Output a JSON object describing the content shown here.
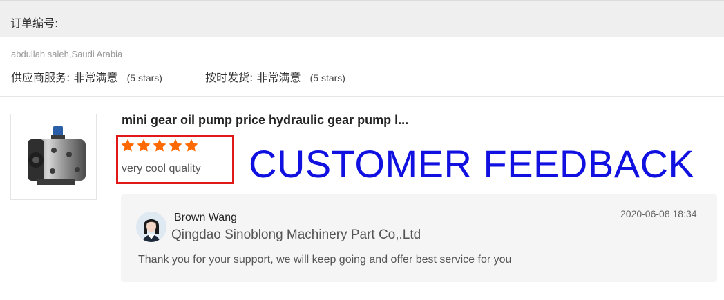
{
  "order": {
    "label": "订单编号:"
  },
  "buyer": {
    "name_country": "abdullah saleh,Saudi Arabia"
  },
  "ratings": [
    {
      "key": "供应商服务:",
      "value": "非常满意",
      "stars_text": "(5 stars)"
    },
    {
      "key": "按时发货:",
      "value": "非常满意",
      "stars_text": "(5 stars)"
    }
  ],
  "product": {
    "title": "mini gear oil pump price hydraulic gear pump l...",
    "image_icon": "hydraulic-gear-pump"
  },
  "review": {
    "star_count": 5,
    "star_color": "#ff6a00",
    "text": "very cool quality"
  },
  "overlay": {
    "title": "CUSTOMER FEEDBACK",
    "color": "#1010e0",
    "highlight_color": "#e01818"
  },
  "reply": {
    "name": "Brown Wang",
    "company": "Qingdao Sinoblong Machinery Part Co,.Ltd",
    "date": "2020-06-08 18:34",
    "text": "Thank you for your support, we will keep going and offer best service for you"
  }
}
